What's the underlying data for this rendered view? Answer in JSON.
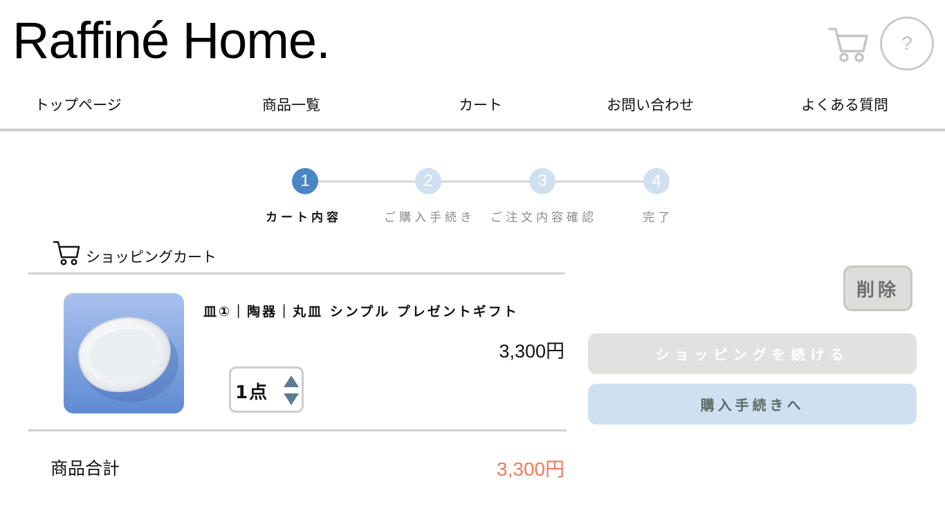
{
  "header": {
    "logo": "Raffiné Home.",
    "help_label": "?"
  },
  "nav": {
    "items": [
      "トップページ",
      "商品一覧",
      "カート",
      "お問い合わせ",
      "よくある質問"
    ]
  },
  "steps": [
    {
      "number": "1",
      "label": "カート内容",
      "active": true
    },
    {
      "number": "2",
      "label": "ご購入手続き",
      "active": false
    },
    {
      "number": "3",
      "label": "ご注文内容確認",
      "active": false
    },
    {
      "number": "4",
      "label": "完了",
      "active": false
    }
  ],
  "cart": {
    "section_title": "ショッピングカート",
    "item": {
      "name": "皿①｜陶器｜丸皿 シンプル プレゼントギフト",
      "price": "3,300円",
      "quantity": "1点"
    },
    "total_label": "商品合計",
    "total_value": "3,300円"
  },
  "actions": {
    "delete_label": "削除",
    "continue_label": "ショッピングを続ける",
    "checkout_label": "購入手続きへ"
  },
  "colors": {
    "step_active": "#4a86c4",
    "step_inactive": "#cfe0f0",
    "total_price": "#f07a5a",
    "checkout_bg": "#cfe0f0",
    "continue_bg": "#e1e1df"
  }
}
